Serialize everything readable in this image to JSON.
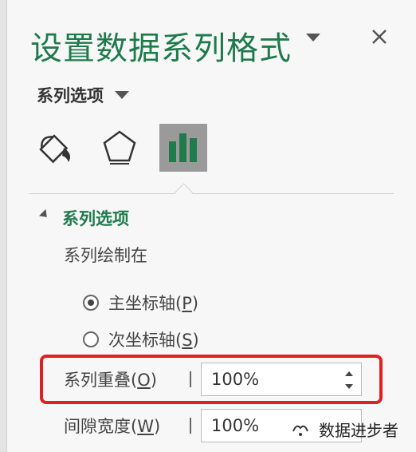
{
  "window": {
    "title": "设置数据系列格式"
  },
  "options_dropdown": {
    "label": "系列选项"
  },
  "tabs": [
    {
      "icon": "paint-bucket-icon",
      "name": "fill-line"
    },
    {
      "icon": "pentagon-icon",
      "name": "effects"
    },
    {
      "icon": "bar-chart-icon",
      "name": "series-options",
      "active": true
    }
  ],
  "section": {
    "header": "系列选项",
    "plot_on_label": "系列绘制在",
    "radios": [
      {
        "label": "主坐标轴(",
        "key": "P",
        "suffix": ")",
        "checked": true
      },
      {
        "label": "次坐标轴(",
        "key": "S",
        "suffix": ")",
        "checked": false
      }
    ],
    "fields": [
      {
        "label": "系列重叠(",
        "key": "O",
        "suffix": ")",
        "value": "100%"
      },
      {
        "label": "间隙宽度(",
        "key": "W",
        "suffix": ")",
        "value": "100%"
      }
    ]
  },
  "watermark": {
    "text": "数据进步者"
  },
  "colors": {
    "accent_green": "#1f7a4c",
    "highlight_red": "#e02020"
  }
}
